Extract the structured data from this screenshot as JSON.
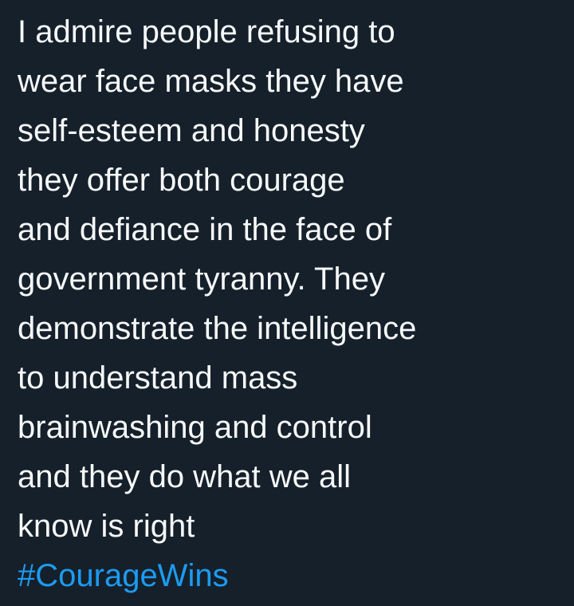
{
  "tweet": {
    "lines": [
      "I admire people refusing to",
      "wear face masks they have",
      "self-esteem and honesty",
      "they offer both courage",
      "and defiance in the face of",
      "government tyranny. They",
      "demonstrate the intelligence",
      "to understand mass",
      "brainwashing and control",
      "and they do what we all",
      "know is right"
    ],
    "hashtag": "#CourageWins"
  },
  "colors": {
    "background": "#15202b",
    "text": "#f7f9f9",
    "hashtag": "#1d9bf0"
  }
}
